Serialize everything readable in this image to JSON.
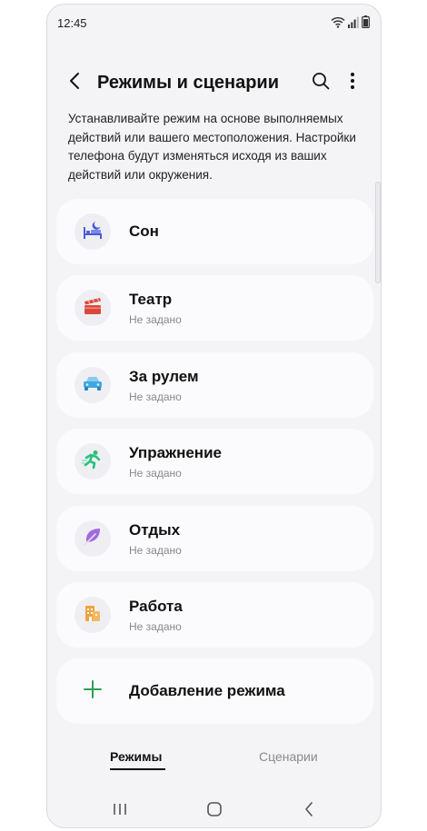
{
  "status": {
    "time": "12:45"
  },
  "header": {
    "title": "Режимы и сценарии"
  },
  "description": "Устанавливайте режим на основе выполняемых действий или вашего местоположения. Настройки телефона будут изменяться исходя из ваших действий или окружения.",
  "modes": [
    {
      "title": "Сон",
      "subtitle": "",
      "icon": "bed-icon",
      "color": "#4a5bd6"
    },
    {
      "title": "Театр",
      "subtitle": "Не задано",
      "icon": "clapperboard-icon",
      "color": "#d9483b"
    },
    {
      "title": "За рулем",
      "subtitle": "Не задано",
      "icon": "car-icon",
      "color": "#3fa7e3"
    },
    {
      "title": "Упражнение",
      "subtitle": "Не задано",
      "icon": "running-icon",
      "color": "#27c07d"
    },
    {
      "title": "Отдых",
      "subtitle": "Не задано",
      "icon": "leaf-icon",
      "color": "#a06ae0"
    },
    {
      "title": "Работа",
      "subtitle": "Не задано",
      "icon": "building-icon",
      "color": "#f0a241"
    },
    {
      "title": "Добавление режима",
      "subtitle": "",
      "icon": "plus-icon",
      "color": "#2e9e55"
    }
  ],
  "tabs": [
    {
      "label": "Режимы",
      "active": true
    },
    {
      "label": "Сценарии",
      "active": false
    }
  ]
}
